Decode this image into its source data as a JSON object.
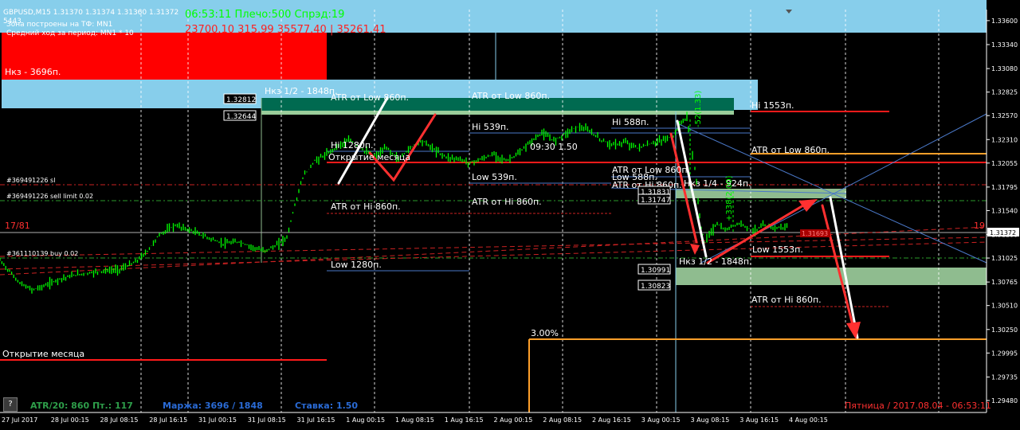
{
  "header": {
    "symbol_line": "GBPUSD,M15  1.31370 1.31374 1.31360 1.31372",
    "green_line": "06:53:11 Плечо:500 Спрэд:19",
    "red_line": "23700.10 315.99 35577.40 | 35261.41",
    "line2": "Зона построены на ТФ: MN1",
    "line3": "Средний ход за период: MN1 * 10",
    "counter": "5443"
  },
  "footer": {
    "atr": "ATR/20: 860  Пт.: 117",
    "margin": "Маржа: 3696 / 1848",
    "rate": "Ставка: 1.50",
    "datetime": "Пятница  / 2017.08.04 - 06:53:11",
    "help": "?"
  },
  "labels": {
    "nkz_3696": "Нкз - 3696п.",
    "nkz_half": "Нкз 1/2 - 1848п.",
    "nkz_half_lower": "Нкз 1/2 - 1848п.",
    "nkz_quarter": "Нкз 1/4 - 924п.",
    "atr_low_1": "ATR от Low 860п.",
    "atr_low_2": "ATR от Low 860п.",
    "atr_low_3": "ATR от Low 860п.",
    "atr_low_4": "ATR от Low 860п.",
    "atr_hi_1": "ATR от Hi 860п.",
    "atr_hi_2": "ATR от Hi 860п.",
    "atr_hi_3": "ATR от Hi 860п.",
    "atr_hi_4": "ATR от Hi 860п.",
    "hi_1280": "Hi 1280п.",
    "hi_539": "Hi 539п.",
    "hi_588": "Hi 588п.",
    "hi_1553": "Hi 1553п.",
    "low_1280": "Low 1280п.",
    "low_539": "Low 539п.",
    "low_588": "Low 588п.",
    "low_1553": "Low 1553п.",
    "month_open_1": "Открытие месяца",
    "month_open_2": "Открытие месяца",
    "time_label": "09:30 1.50",
    "pct": "3.00%",
    "order_sl": "#369491226 sl",
    "order_sell": "#369491226 sell limit 0.02",
    "order_buy": "#361110139 buy 0.02",
    "left_marker": "17/81",
    "right_marker": "19",
    "vert_green_1": "-52(1.33)",
    "vert_green_2": "+338(2.00)",
    "price_box_1": "1.32812",
    "price_box_2": "1.32644",
    "price_box_3": "1.31831",
    "price_box_4": "1.31747",
    "price_box_5": "1.30991",
    "price_box_6": "1.30823",
    "small_red": "1.31693",
    "current_price": "1.31372"
  },
  "colors": {
    "up": "#00ff00",
    "light_blue_zone": "#87ceeb",
    "red_zone": "#ff0000",
    "teal_zone": "#006a50",
    "pale_green_zone": "#8fbc8f",
    "level_red": "#ff1a1a",
    "level_blue": "#4a78c8",
    "level_orange": "#ff9f2a",
    "arrow_red": "#ff3030"
  },
  "chart_data": {
    "type": "candlestick",
    "symbol": "GBPUSD",
    "timeframe": "M15",
    "x_ticks": [
      "27 Jul 2017",
      "28 Jul 00:15",
      "28 Jul 08:15",
      "28 Jul 16:15",
      "31 Jul 00:15",
      "31 Jul 08:15",
      "31 Jul 16:15",
      "1 Aug 00:15",
      "1 Aug 08:15",
      "1 Aug 16:15",
      "2 Aug 00:15",
      "2 Aug 08:15",
      "2 Aug 16:15",
      "3 Aug 00:15",
      "3 Aug 08:15",
      "3 Aug 16:15",
      "4 Aug 00:15"
    ],
    "y_ticks": [
      "1.33600",
      "1.33340",
      "1.33080",
      "1.32825",
      "1.32570",
      "1.32310",
      "1.32055",
      "1.31795",
      "1.31540",
      "1.31280",
      "1.31025",
      "1.30765",
      "1.30510",
      "1.30250",
      "1.29995",
      "1.29735",
      "1.29480"
    ],
    "ylim": [
      1.2935,
      1.3372
    ],
    "price_path": [
      [
        0,
        1.31
      ],
      [
        12,
        1.3088
      ],
      [
        25,
        1.3075
      ],
      [
        40,
        1.3068
      ],
      [
        55,
        1.3072
      ],
      [
        75,
        1.308
      ],
      [
        100,
        1.3085
      ],
      [
        125,
        1.3088
      ],
      [
        150,
        1.309
      ],
      [
        170,
        1.3098
      ],
      [
        185,
        1.311
      ],
      [
        200,
        1.3128
      ],
      [
        220,
        1.3138
      ],
      [
        240,
        1.3132
      ],
      [
        260,
        1.3125
      ],
      [
        280,
        1.3118
      ],
      [
        300,
        1.312
      ],
      [
        315,
        1.3115
      ],
      [
        330,
        1.311
      ],
      [
        345,
        1.3115
      ],
      [
        360,
        1.3125
      ],
      [
        370,
        1.316
      ],
      [
        380,
        1.319
      ],
      [
        395,
        1.3208
      ],
      [
        410,
        1.3215
      ],
      [
        425,
        1.3225
      ],
      [
        440,
        1.323
      ],
      [
        455,
        1.322
      ],
      [
        470,
        1.3212
      ],
      [
        485,
        1.3222
      ],
      [
        500,
        1.321
      ],
      [
        515,
        1.3222
      ],
      [
        530,
        1.323
      ],
      [
        545,
        1.322
      ],
      [
        560,
        1.3212
      ],
      [
        575,
        1.321
      ],
      [
        590,
        1.3206
      ],
      [
        605,
        1.321
      ],
      [
        620,
        1.3215
      ],
      [
        635,
        1.3208
      ],
      [
        650,
        1.3215
      ],
      [
        665,
        1.3228
      ],
      [
        680,
        1.3238
      ],
      [
        695,
        1.323
      ],
      [
        710,
        1.3238
      ],
      [
        725,
        1.3245
      ],
      [
        740,
        1.324
      ],
      [
        755,
        1.323
      ],
      [
        770,
        1.3225
      ],
      [
        785,
        1.3228
      ],
      [
        800,
        1.3222
      ],
      [
        815,
        1.3226
      ],
      [
        830,
        1.323
      ],
      [
        845,
        1.3235
      ],
      [
        855,
        1.325
      ],
      [
        862,
        1.3255
      ],
      [
        866,
        1.323
      ],
      [
        872,
        1.32
      ],
      [
        876,
        1.3165
      ],
      [
        880,
        1.3135
      ],
      [
        884,
        1.312
      ],
      [
        890,
        1.3128
      ],
      [
        900,
        1.314
      ],
      [
        910,
        1.3132
      ],
      [
        920,
        1.3138
      ],
      [
        930,
        1.314
      ],
      [
        945,
        1.3132
      ],
      [
        960,
        1.3138
      ],
      [
        975,
        1.3135
      ],
      [
        990,
        1.3137
      ]
    ]
  }
}
